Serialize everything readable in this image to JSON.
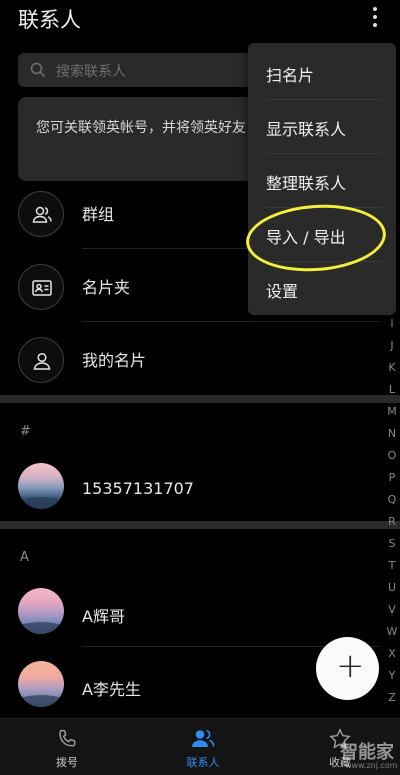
{
  "header": {
    "title": "联系人",
    "more_icon": "more-vertical-icon"
  },
  "search": {
    "placeholder": "搜索联系人",
    "icon": "search-icon"
  },
  "notice": {
    "text": "您可关联领英帐号，并将领英好友"
  },
  "quick_rows": [
    {
      "label": "群组",
      "icon": "group-icon"
    },
    {
      "label": "名片夹",
      "icon": "business-card-icon"
    },
    {
      "label": "我的名片",
      "icon": "person-icon"
    }
  ],
  "sections": [
    {
      "header": "#",
      "contacts": [
        {
          "name": "15357131707"
        }
      ]
    },
    {
      "header": "A",
      "contacts": [
        {
          "name": "A辉哥"
        },
        {
          "name": "A李先生"
        }
      ]
    }
  ],
  "alphabet_visible": [
    "I",
    "J",
    "K",
    "L",
    "M",
    "N",
    "O",
    "P",
    "Q",
    "R",
    "S",
    "T",
    "U",
    "V",
    "W",
    "X",
    "Y",
    "Z"
  ],
  "menu": {
    "items": [
      {
        "label": "扫名片"
      },
      {
        "label": "显示联系人"
      },
      {
        "label": "整理联系人"
      },
      {
        "label": "导入 / 导出"
      },
      {
        "label": "设置"
      }
    ]
  },
  "fab": {
    "label": "+"
  },
  "bottom_nav": {
    "tabs": [
      {
        "label": "拨号",
        "icon": "phone-icon",
        "active": false
      },
      {
        "label": "联系人",
        "icon": "contacts-icon",
        "active": true
      },
      {
        "label": "收藏",
        "icon": "star-icon",
        "active": false
      }
    ],
    "active_color": "#2f8cf0"
  },
  "watermark": {
    "text": "智能家",
    "url": "www.znj.com"
  },
  "colors": {
    "background": "#000000",
    "surface": "#2a2a2a",
    "highlight": "#f3ef3a"
  }
}
